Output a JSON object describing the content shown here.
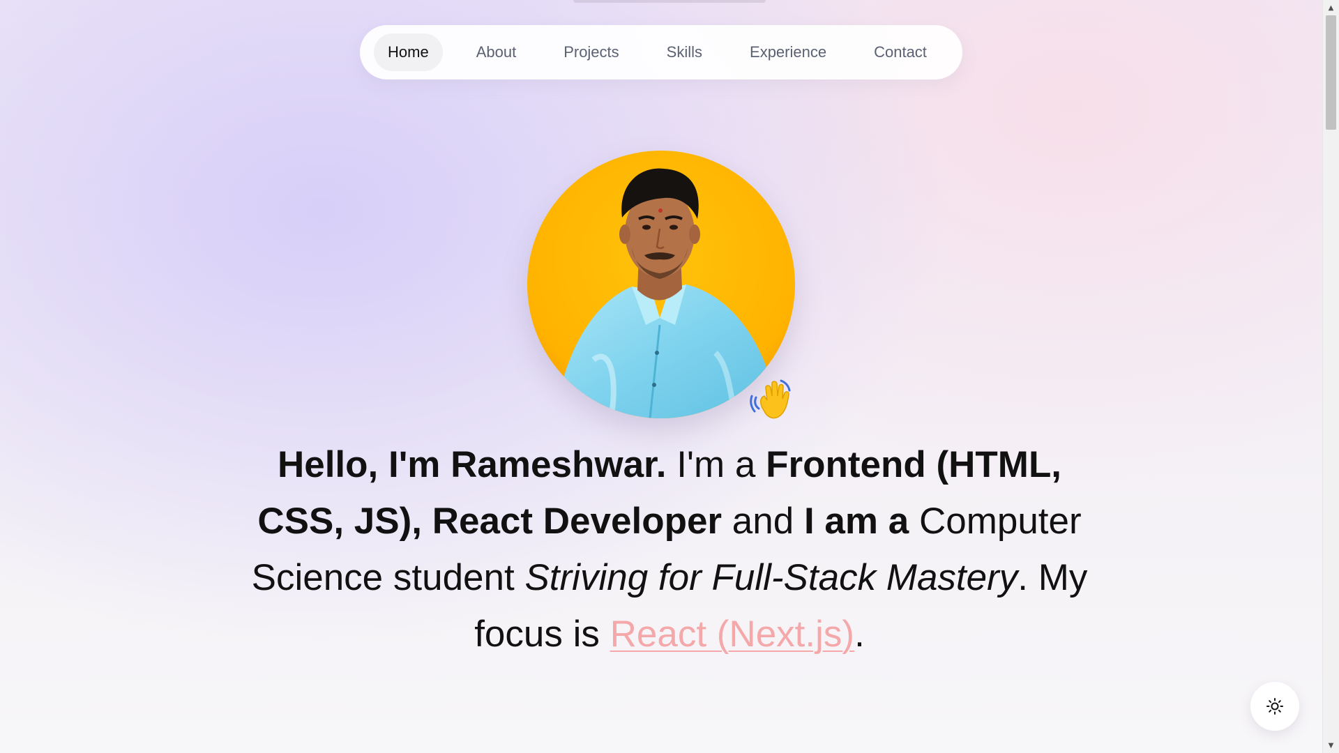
{
  "nav": {
    "items": [
      {
        "label": "Home",
        "active": true
      },
      {
        "label": "About"
      },
      {
        "label": "Projects"
      },
      {
        "label": "Skills"
      },
      {
        "label": "Experience"
      },
      {
        "label": "Contact"
      }
    ]
  },
  "avatar": {
    "icon": "profile-photo",
    "badge_icon": "waving-hand-icon"
  },
  "intro": {
    "hello": "Hello, I'm Rameshwar.",
    "im_a": " I'm a ",
    "role": "Frontend (HTML, CSS, JS), React Developer",
    "and": " and ",
    "i_am_a": "I am a",
    "student": " Computer Science student ",
    "striving": "Striving for Full-Stack Mastery",
    "focus": ". My focus is ",
    "focus_link": "React (Next.js)",
    "period": "."
  },
  "theme_toggle": {
    "icon": "sun-icon"
  },
  "colors": {
    "accent_link": "#f4a8aa",
    "avatar_bg": "#ffb300"
  }
}
